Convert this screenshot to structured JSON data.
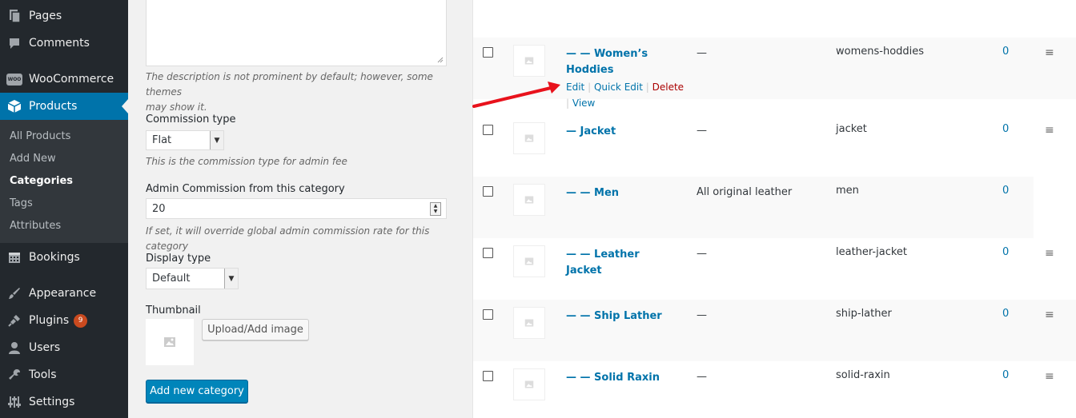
{
  "sidebar": {
    "menu": {
      "pages": "Pages",
      "comments": "Comments",
      "woocommerce": "WooCommerce",
      "woo_logo": "WOO",
      "products": "Products",
      "bookings": "Bookings",
      "appearance": "Appearance",
      "plugins": "Plugins",
      "plugins_badge": "9",
      "users": "Users",
      "tools": "Tools",
      "settings": "Settings"
    },
    "submenu": {
      "all_products": "All Products",
      "add_new": "Add New",
      "categories": "Categories",
      "tags": "Tags",
      "attributes": "Attributes"
    }
  },
  "form": {
    "description_help_line1": "The description is not prominent by default; however, some themes",
    "description_help_line2": "may show it.",
    "commission_type_label": "Commission type",
    "commission_type_value": "Flat",
    "commission_type_help": "This is the commission type for admin fee",
    "admin_commission_label": "Admin Commission from this category",
    "admin_commission_value": "20",
    "admin_commission_help": "If set, it will override global admin commission rate for this category",
    "display_type_label": "Display type",
    "display_type_value": "Default",
    "thumbnail_label": "Thumbnail",
    "upload_button": "Upload/Add image",
    "submit_button": "Add new category"
  },
  "table": {
    "rows": [
      {
        "name_line1": "— — Women’s",
        "name_line2": "Hoddies",
        "description": "—",
        "slug": "womens-hoddies",
        "count": "0"
      },
      {
        "name_line1": "— Jacket",
        "description": "—",
        "slug": "jacket",
        "count": "0"
      },
      {
        "name_line1": "— — Men",
        "description": "All original leather",
        "slug": "men",
        "count": "0"
      },
      {
        "name_line1": "— — Leather Jacket",
        "description": "—",
        "slug": "leather-jacket",
        "count": "0"
      },
      {
        "name_line1": "— — Ship Lather",
        "description": "—",
        "slug": "ship-lather",
        "count": "0"
      },
      {
        "name_line1": "— — Solid Raxin",
        "description": "—",
        "slug": "solid-raxin",
        "count": "0"
      }
    ],
    "row_actions": {
      "edit": "Edit",
      "quick_edit": "Quick Edit",
      "delete": "Delete",
      "view": "View",
      "separator": "|"
    },
    "handle_icon": "≡"
  },
  "colors": {
    "sidebar_bg": "#23282d",
    "submenu_bg": "#32373c",
    "accent": "#0073aa",
    "primary_button": "#0085ba",
    "delete": "#aa0000",
    "annotation_arrow": "#e8121c",
    "badge": "#ca4a1f"
  },
  "icons": {
    "pages": "pages-icon",
    "comments": "comments-icon",
    "woocommerce": "woocommerce-logo",
    "products": "products-box-icon",
    "bookings": "calendar-icon",
    "appearance": "paintbrush-icon",
    "plugins": "plug-icon",
    "users": "user-icon",
    "tools": "wrench-icon",
    "settings": "settings-sliders-icon",
    "thumbnail_placeholder": "image-placeholder-icon",
    "drag_handle": "drag-handle-icon"
  }
}
